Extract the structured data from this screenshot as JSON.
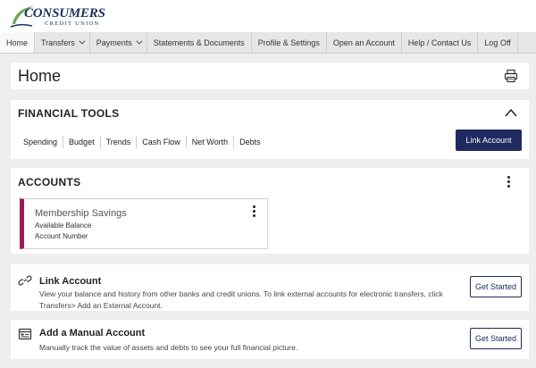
{
  "brand": {
    "name": "CONSUMERS",
    "tagline": "CREDIT UNION"
  },
  "nav": {
    "items": [
      {
        "label": "Home",
        "active": true
      },
      {
        "label": "Transfers",
        "dropdown": true
      },
      {
        "label": "Payments",
        "dropdown": true
      },
      {
        "label": "Statements & Documents"
      },
      {
        "label": "Profile & Settings"
      },
      {
        "label": "Open an Account"
      },
      {
        "label": "Help / Contact Us"
      },
      {
        "label": "Log Off"
      }
    ]
  },
  "page": {
    "title": "Home"
  },
  "financial_tools": {
    "title": "FINANCIAL TOOLS",
    "links": [
      "Spending",
      "Budget",
      "Trends",
      "Cash Flow",
      "Net Worth",
      "Debts"
    ],
    "cta_label": "Link Account"
  },
  "accounts": {
    "title": "ACCOUNTS",
    "items": [
      {
        "name": "Membership Savings",
        "line1": "Available Balance",
        "line2": "Account Number"
      }
    ]
  },
  "link_account": {
    "title": "Link Account",
    "description": "View your balance and history from other banks and credit unions. To link external accounts for electronic transfers, click Transfers> Add an External Account.",
    "button_label": "Get Started"
  },
  "manual_account": {
    "title": "Add a Manual Account",
    "description": "Manually track the value of assets and debts to see your full financial picture.",
    "button_label": "Get Started"
  },
  "colors": {
    "primary": "#1f2a60",
    "account_accent": "#9b1c5a",
    "logo_green": "#6aa84f",
    "logo_navy": "#1a3262"
  },
  "icons": {
    "print": "printer-icon",
    "collapse": "chevron-up-icon",
    "kebab": "kebab-menu-icon",
    "link": "link-icon",
    "manual": "ledger-icon"
  }
}
